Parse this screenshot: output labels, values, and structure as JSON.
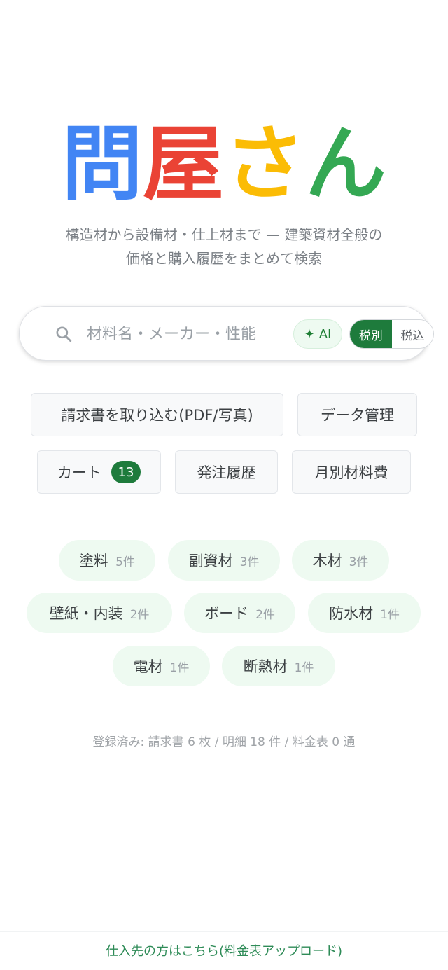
{
  "logo": {
    "chars": [
      "問",
      "屋",
      "さ",
      "ん"
    ],
    "colors": [
      "#4285f4",
      "#ea4335",
      "#fbbc05",
      "#34a853"
    ]
  },
  "tagline": {
    "line1": "構造材から設備材・仕上材まで — 建築資材全般の",
    "line2": "価格と購入履歴をまとめて検索"
  },
  "search": {
    "icon": "search-icon",
    "placeholder": "材料名・メーカー・性能",
    "value": "",
    "ai_label": "AI",
    "ai_icon": "sparkle-icon",
    "tax_options": [
      "税別",
      "税込"
    ],
    "tax_selected": "税別"
  },
  "actions": {
    "import_label": "請求書を取り込む(PDF/写真)",
    "data_label": "データ管理",
    "cart_label": "カート",
    "cart_count": "13",
    "history_label": "発注履歴",
    "monthly_label": "月別材料費"
  },
  "categories": [
    {
      "label": "塗料",
      "count": "5件"
    },
    {
      "label": "副資材",
      "count": "3件"
    },
    {
      "label": "木材",
      "count": "3件"
    },
    {
      "label": "壁紙・内装",
      "count": "2件"
    },
    {
      "label": "ボード",
      "count": "2件"
    },
    {
      "label": "防水材",
      "count": "1件"
    },
    {
      "label": "電材",
      "count": "1件"
    },
    {
      "label": "断熱材",
      "count": "1件"
    }
  ],
  "stats": "登録済み: 請求書 6 枚 / 明細 18 件 / 料金表 0 通",
  "footer": {
    "supplier_link": "仕入先の方はこちら(料金表アップロード)"
  },
  "colors": {
    "accent_green": "#1e7b3c",
    "chip_bg": "#eefaf1"
  }
}
